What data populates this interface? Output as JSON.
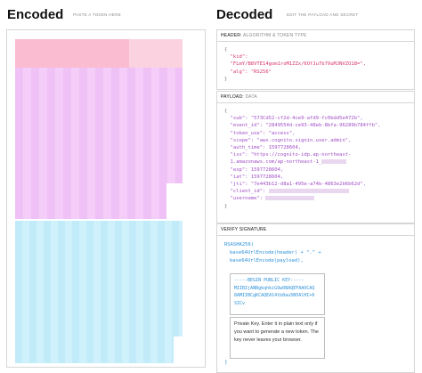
{
  "encoded": {
    "title": "Encoded",
    "subtitle": "PASTE A TOKEN HERE"
  },
  "decoded": {
    "title": "Decoded",
    "subtitle": "EDIT THE PAYLOAD AND SECRET"
  },
  "header_section": {
    "label": "HEADER:",
    "label_sub": "ALGORITHM & TOKEN TYPE",
    "open": "{",
    "kid_key": "\"kid\":",
    "kid_value": "\"FLmY/B8VTE14gom1roM1ZZx/6OfJu7b79uMJNVZO18=\",",
    "alg_key": "\"alg\":",
    "alg_value": "\"RS256\"",
    "close": "}"
  },
  "payload_section": {
    "label": "PAYLOAD:",
    "label_sub": "DATA",
    "open": "{",
    "lines": [
      {
        "k": "\"sub\":",
        "v": "\"573Cd52-cf2d-4ce9-afd9-fc0bdd5e472b\","
      },
      {
        "k": "\"event_id\":",
        "v": "\"2849554d-ce93-48eb-8bfa-96289b784ffb\","
      },
      {
        "k": "\"token_use\":",
        "v": "\"access\","
      },
      {
        "k": "\"scope\":",
        "v": "\"aws.cognito.signin.user.admin\","
      },
      {
        "k": "\"auth_time\":",
        "v": "1597728604,"
      },
      {
        "k": "\"iss\":",
        "v": "\"https://cognito-idp.ap-northeast-"
      },
      {
        "k": "",
        "v": "1.amazonaws.com/ap-northeast-1_"
      },
      {
        "k": "\"exp\":",
        "v": "1597728604,"
      },
      {
        "k": "\"iat\":",
        "v": "1597728604,"
      },
      {
        "k": "\"jti\":",
        "v": "\"7e443b12-d8a1-495e-a74b-4863e2b6b62d\","
      },
      {
        "k": "\"client_id\":",
        "v": ""
      },
      {
        "k": "\"username\":",
        "v": ""
      }
    ],
    "close": "}"
  },
  "verify_section": {
    "label": "VERIFY SIGNATURE",
    "alg_line": "RSASHA256(",
    "line2": "base64UrlEncode(header) + \".\" +",
    "line3": "base64UrlEncode(payload),",
    "public_key_lines": [
      "-----BEGIN PUBLIC KEY-----",
      "MIIBIjANBgkqhkiG9w0BAQEFAAOCAQ",
      "8AMIIBCgKCAQEA14tb8au5N5AlHI+0",
      "SICv"
    ],
    "private_key_text": "Private Key. Enter it in plain text only if you want to generate a new token. The key never leaves your browser.",
    "close": ")"
  }
}
